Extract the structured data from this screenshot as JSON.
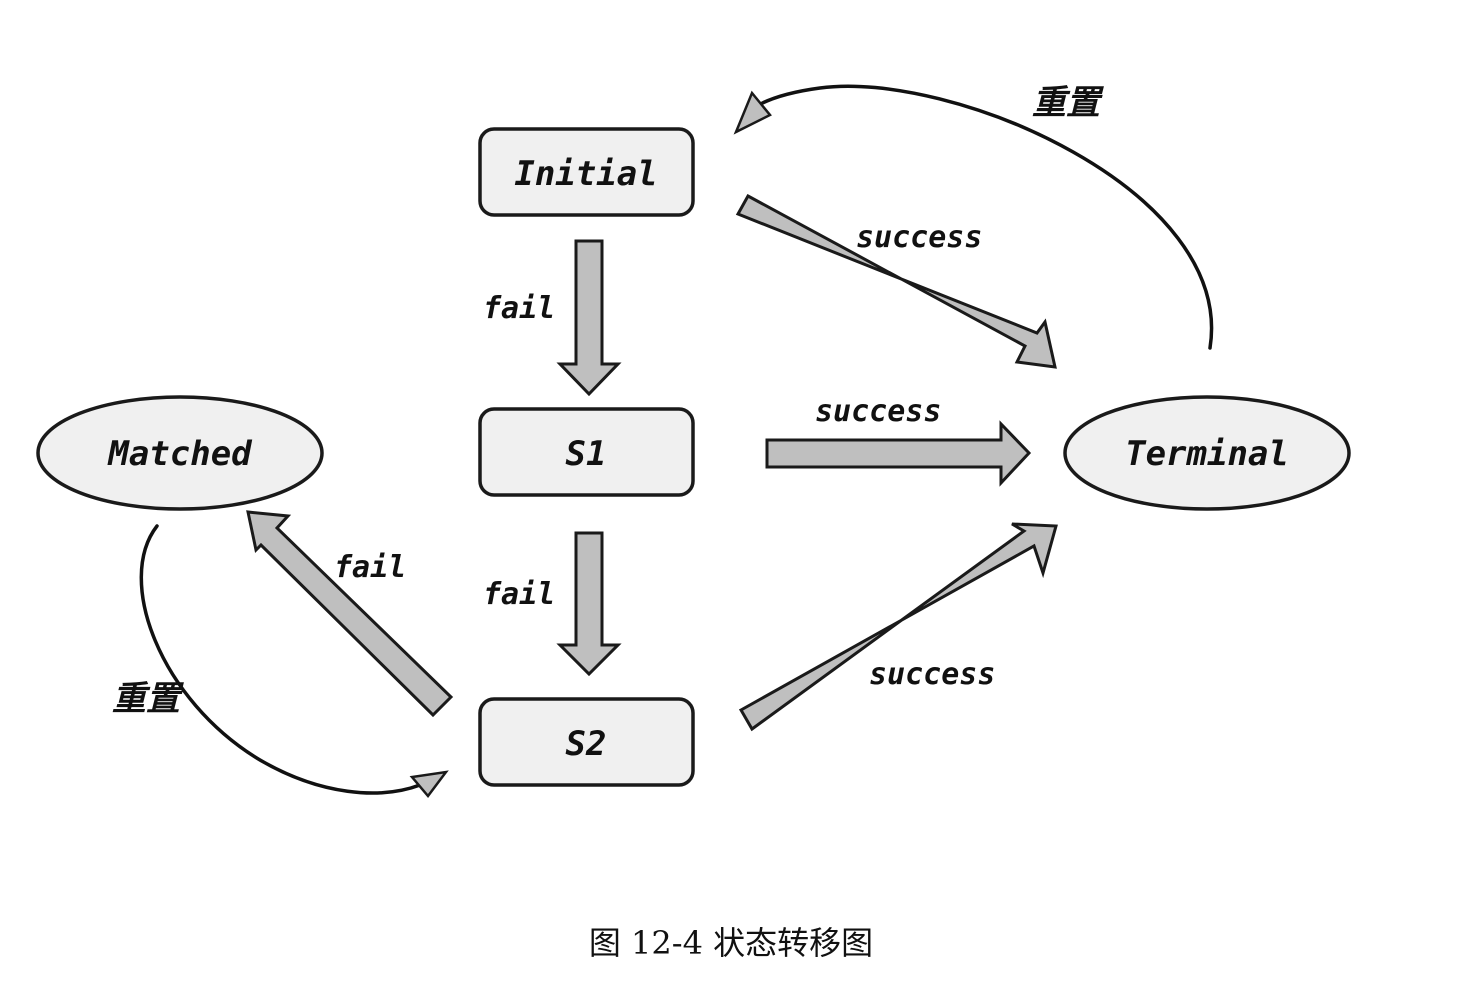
{
  "diagram": {
    "nodes": {
      "initial": "Initial",
      "s1": "S1",
      "s2": "S2",
      "matched": "Matched",
      "terminal": "Terminal"
    },
    "edges": {
      "initial_to_s1": "fail",
      "s1_to_s2": "fail",
      "s2_to_matched": "fail",
      "initial_to_terminal": "success",
      "s1_to_terminal": "success",
      "s2_to_terminal": "success",
      "terminal_to_initial": "重置",
      "matched_to_s2": "重置"
    },
    "caption": "图 12-4  状态转移图",
    "colors": {
      "node_fill": "#f0f0f0",
      "arrow_fill": "#bfbfbf",
      "stroke": "#1a1a1a"
    }
  }
}
